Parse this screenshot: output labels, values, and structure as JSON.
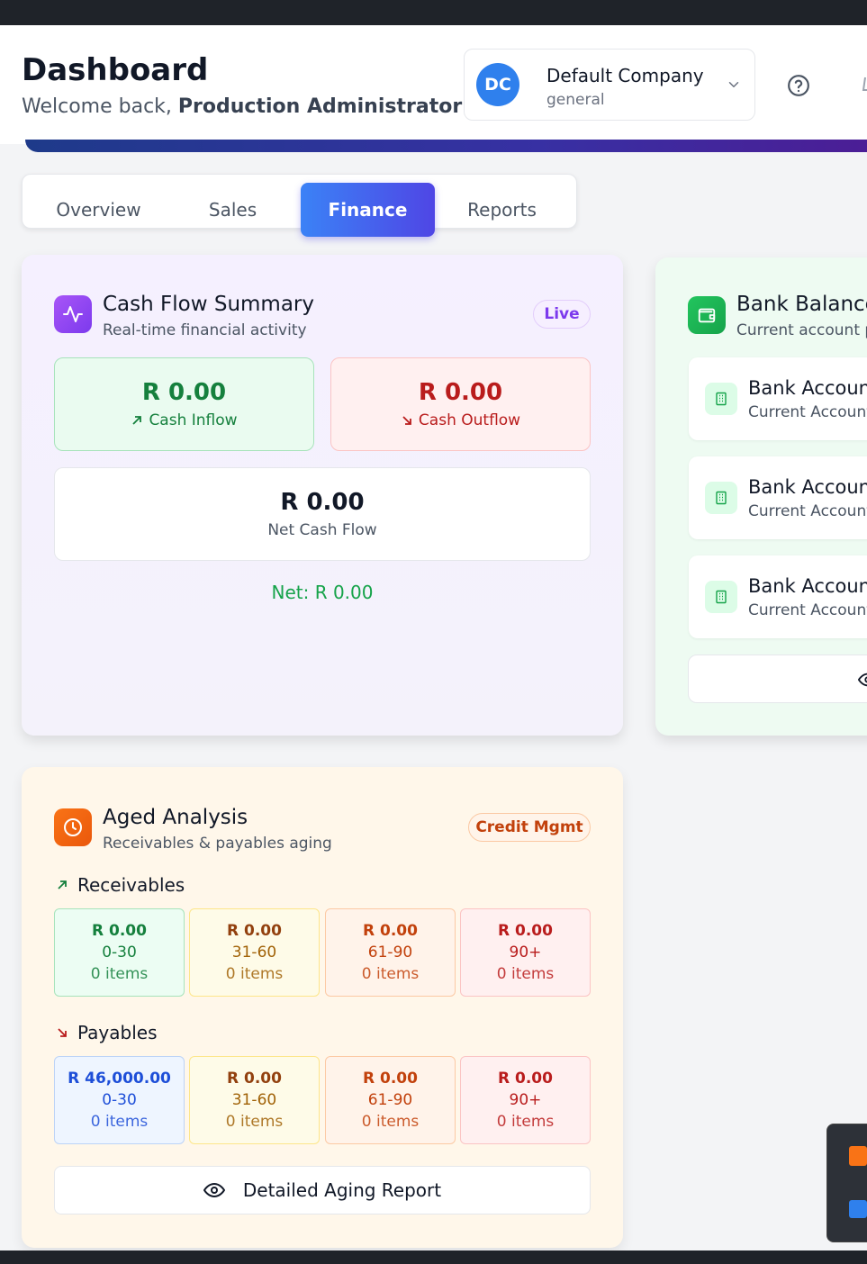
{
  "header": {
    "title": "Dashboard",
    "welcome_prefix": "Welcome back, ",
    "user_name": "Production Administrator"
  },
  "company": {
    "initials": "DC",
    "name": "Default Company",
    "subtitle": "general"
  },
  "tabs": [
    {
      "label": "Overview",
      "active": false
    },
    {
      "label": "Sales",
      "active": false
    },
    {
      "label": "Finance",
      "active": true
    },
    {
      "label": "Reports",
      "active": false
    }
  ],
  "cash_flow": {
    "title": "Cash Flow Summary",
    "subtitle": "Real-time financial activity",
    "badge": "Live",
    "inflow": {
      "amount": "R 0.00",
      "label": "Cash Inflow"
    },
    "outflow": {
      "amount": "R 0.00",
      "label": "Cash Outflow"
    },
    "net_flow": {
      "amount": "R 0.00",
      "label": "Net Cash Flow"
    },
    "net_summary": "Net: R 0.00"
  },
  "bank": {
    "title": "Bank Balances",
    "subtitle": "Current account p",
    "accounts": [
      {
        "name": "Bank Account",
        "type": "Current Account"
      },
      {
        "name": "Bank Account",
        "type": "Current Account"
      },
      {
        "name": "Bank Account",
        "type": "Current Account"
      }
    ]
  },
  "aged": {
    "title": "Aged Analysis",
    "subtitle": "Receivables & payables aging",
    "badge": "Credit Mgmt",
    "receivables_label": "Receivables",
    "payables_label": "Payables",
    "receivables": [
      {
        "amount": "R 0.00",
        "range": "0-30",
        "items": "0 items"
      },
      {
        "amount": "R 0.00",
        "range": "31-60",
        "items": "0 items"
      },
      {
        "amount": "R 0.00",
        "range": "61-90",
        "items": "0 items"
      },
      {
        "amount": "R 0.00",
        "range": "90+",
        "items": "0 items"
      }
    ],
    "payables": [
      {
        "amount": "R 46,000.00",
        "range": "0-30",
        "items": "0 items"
      },
      {
        "amount": "R 0.00",
        "range": "31-60",
        "items": "0 items"
      },
      {
        "amount": "R 0.00",
        "range": "61-90",
        "items": "0 items"
      },
      {
        "amount": "R 0.00",
        "range": "90+",
        "items": "0 items"
      }
    ],
    "report_button": "Detailed Aging Report"
  },
  "colors": {
    "accent": "#4f46e5",
    "inflow": "#15803d",
    "outflow": "#b91c1c",
    "purple": "#7c3aed",
    "green": "#16a34a",
    "orange": "#ea580c"
  }
}
